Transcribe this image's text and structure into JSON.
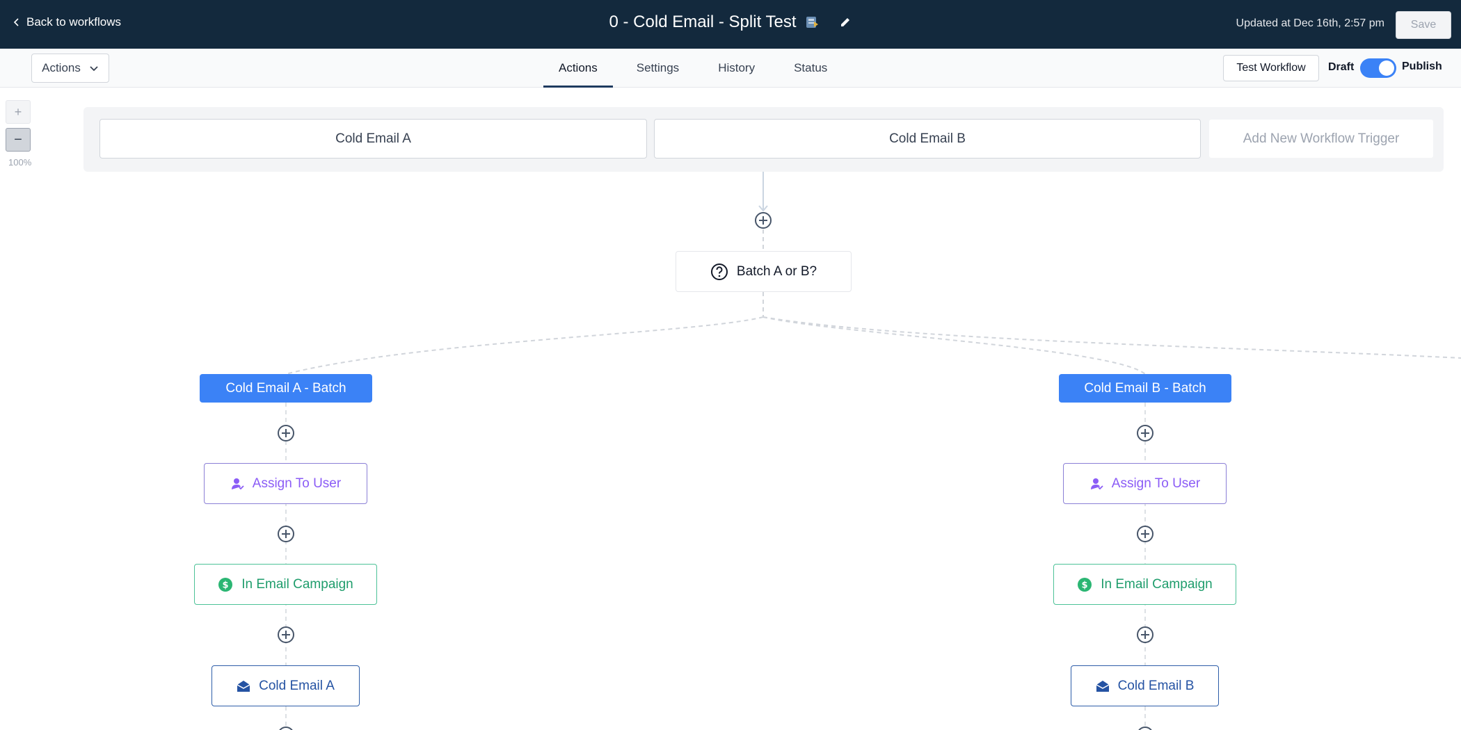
{
  "header": {
    "back_label": "Back to workflows",
    "title": "0 - Cold Email - Split Test",
    "updated": "Updated at Dec 16th, 2:57 pm",
    "save_label": "Save"
  },
  "subbar": {
    "actions_label": "Actions",
    "tabs": [
      {
        "label": "Actions",
        "active": true
      },
      {
        "label": "Settings",
        "active": false
      },
      {
        "label": "History",
        "active": false
      },
      {
        "label": "Status",
        "active": false
      }
    ],
    "test_workflow_label": "Test Workflow",
    "draft_label": "Draft",
    "publish_label": "Publish",
    "published": true
  },
  "zoom": {
    "plus_label": "+",
    "minus_label": "−",
    "level": "100%"
  },
  "triggers": [
    {
      "label": "Cold Email A"
    },
    {
      "label": "Cold Email B"
    }
  ],
  "add_trigger_label": "Add New Workflow Trigger",
  "decision": {
    "label": "Batch A or B?"
  },
  "branches": {
    "a": {
      "batch": "Cold Email A - Batch",
      "assign": "Assign To User",
      "campaign": "In Email Campaign",
      "email": "Cold Email A"
    },
    "b": {
      "batch": "Cold Email B - Batch",
      "assign": "Assign To User",
      "campaign": "In Email Campaign",
      "email": "Cold Email B"
    }
  },
  "colors": {
    "topbar": "#13293d",
    "accent": "#3b82f6",
    "assign": "#8b5cf6",
    "campaign": "#1f9d6c",
    "email": "#2553a3"
  }
}
